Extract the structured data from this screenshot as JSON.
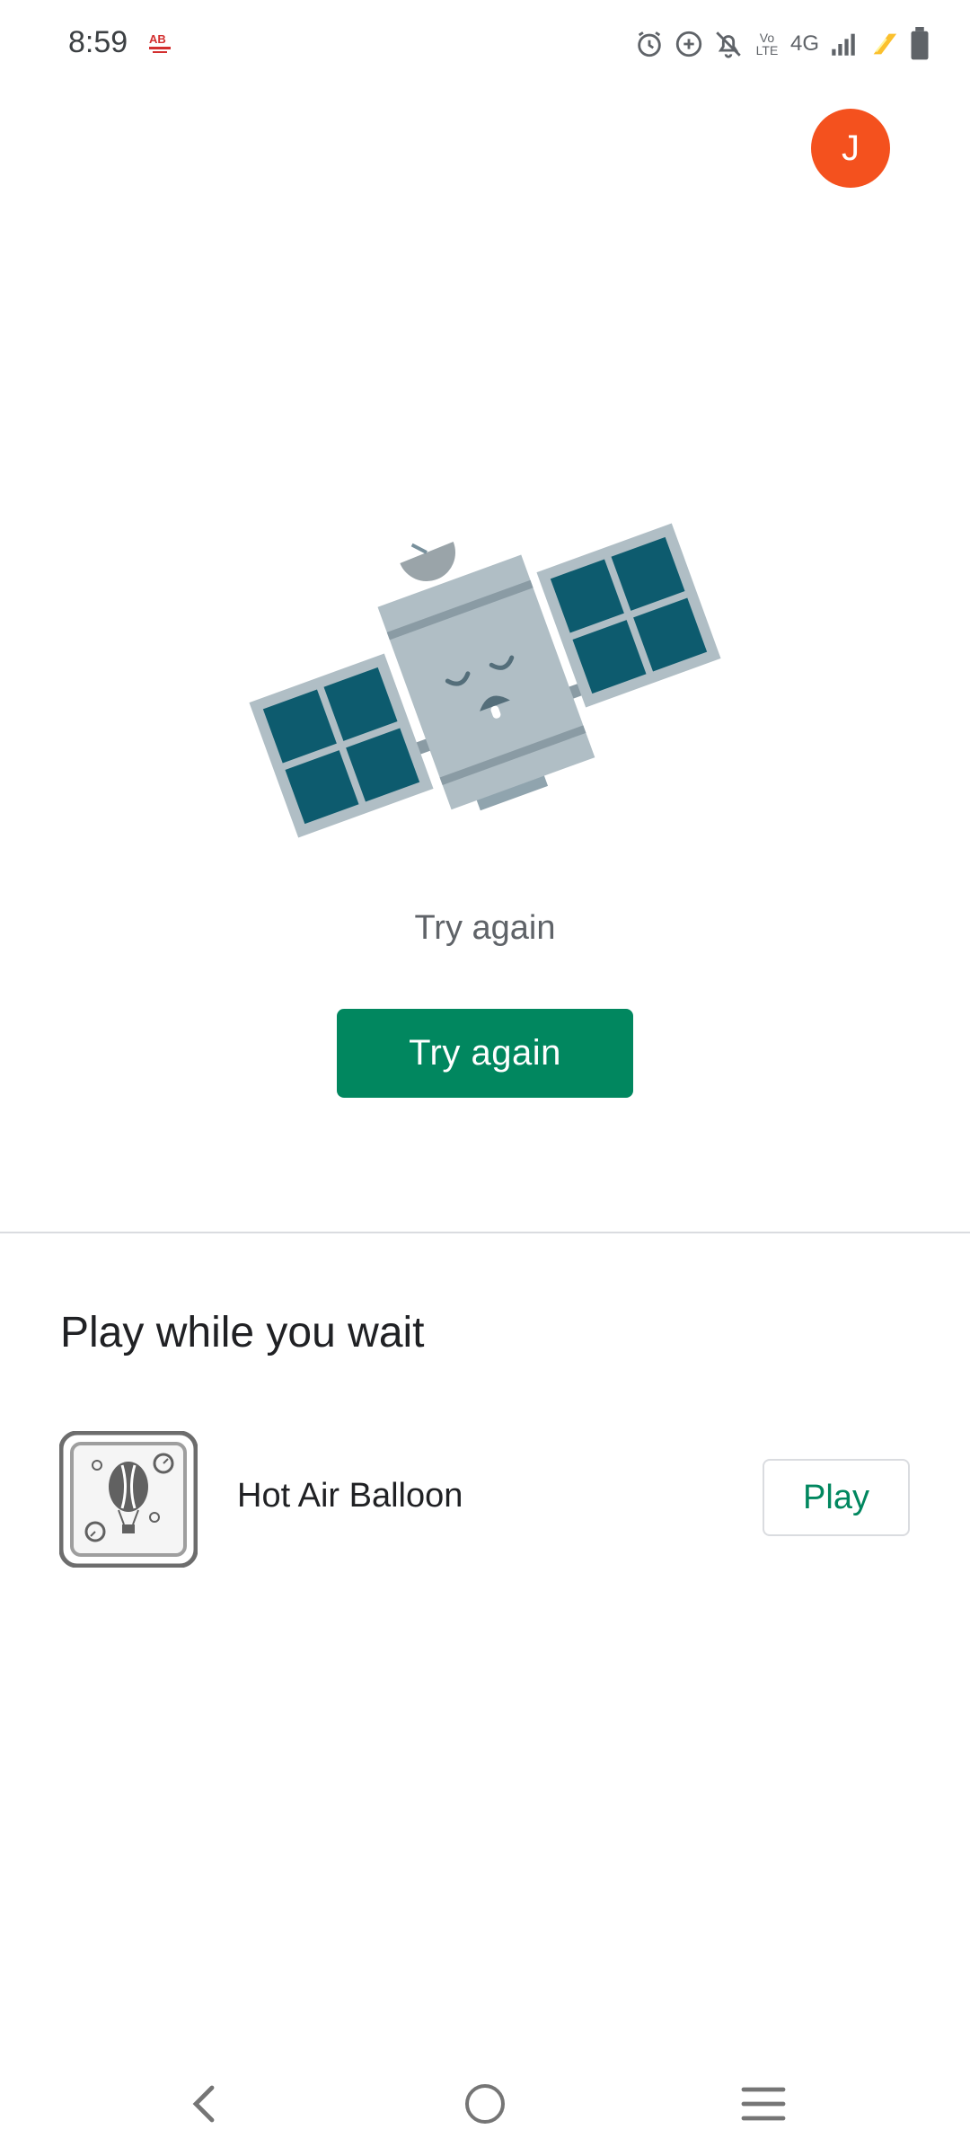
{
  "status_bar": {
    "time": "8:59",
    "network_label": "4G",
    "volte_label": "Vo LTE",
    "icons": [
      "alarm-icon",
      "data-saver-icon",
      "notifications-off-icon",
      "volte-icon",
      "network-4g",
      "signal-icon",
      "charging-icon",
      "battery-icon"
    ]
  },
  "account": {
    "initial": "J",
    "color": "#f4511e"
  },
  "error": {
    "illustration": "sleeping-satellite",
    "message": "Try again",
    "button_label": "Try again",
    "button_color": "#01875f"
  },
  "play_section": {
    "title": "Play while you wait",
    "games": [
      {
        "name": "Hot Air Balloon",
        "icon": "hot-air-balloon-icon",
        "button_label": "Play"
      }
    ],
    "accent_color": "#01875f"
  },
  "nav_bar": {
    "buttons": [
      "back-icon",
      "home-icon",
      "recents-icon"
    ]
  }
}
